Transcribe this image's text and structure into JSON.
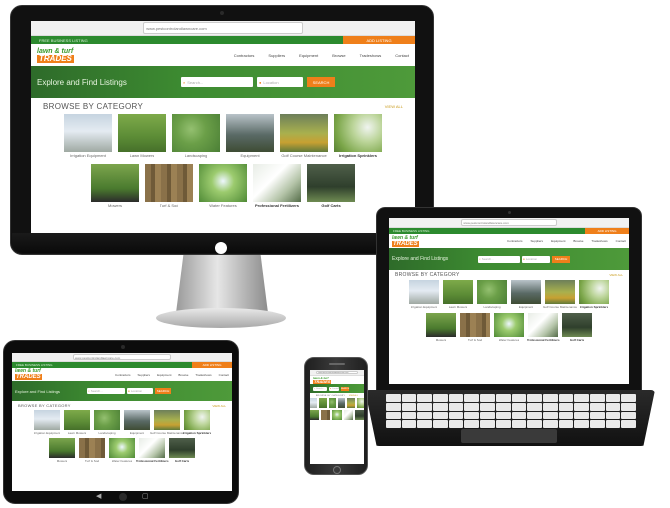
{
  "site": {
    "url": "www.pestcontrolandlawncare.com",
    "promo_text": "FREE BUSINESS LISTING",
    "promo_cta": "ADD LISTING",
    "logo_top": "lawn & turf",
    "logo_bottom": "TRADES",
    "nav": [
      "Contractors",
      "Suppliers",
      "Equipment",
      "Browse",
      "Tradeshows",
      "Contact"
    ],
    "hero_title": "Explore and Find Listings",
    "search_placeholder": "Search...",
    "location_placeholder": "Location",
    "search_button": "SEARCH",
    "browse_title": "BROWSE BY CATEGORY",
    "view_all": "VIEW ALL",
    "categories_row1": [
      {
        "label": "Irrigation Equipment",
        "photo": "sprinkler-head-sky",
        "bold": false
      },
      {
        "label": "Lawn Mowers",
        "photo": "ride-on-mower",
        "bold": false
      },
      {
        "label": "Landscaping",
        "photo": "wet-grass",
        "bold": false
      },
      {
        "label": "Equipment",
        "photo": "tractor",
        "bold": false
      },
      {
        "label": "Golf Course Maintenance",
        "photo": "golf-course",
        "bold": false
      },
      {
        "label": "Irrigation Sprinklers",
        "photo": "sprinkler-spray",
        "bold": true
      }
    ],
    "categories_row2": [
      {
        "label": "Mowers",
        "photo": "mower",
        "bold": false
      },
      {
        "label": "Turf & Sod",
        "photo": "sod-rolls",
        "bold": false
      },
      {
        "label": "Water Features",
        "photo": "fountain",
        "bold": false
      },
      {
        "label": "Professional Fertilizers",
        "photo": "fertilizer-bag",
        "bold": true
      },
      {
        "label": "Golf Carts",
        "photo": "golf-cart",
        "bold": true
      }
    ]
  },
  "devices": {
    "monitor": "desktop-monitor",
    "laptop": "laptop",
    "tablet": "tablet",
    "phone": "smartphone"
  },
  "colors": {
    "brand_green": "#2c8a2e",
    "accent_orange": "#ef7f1a"
  }
}
